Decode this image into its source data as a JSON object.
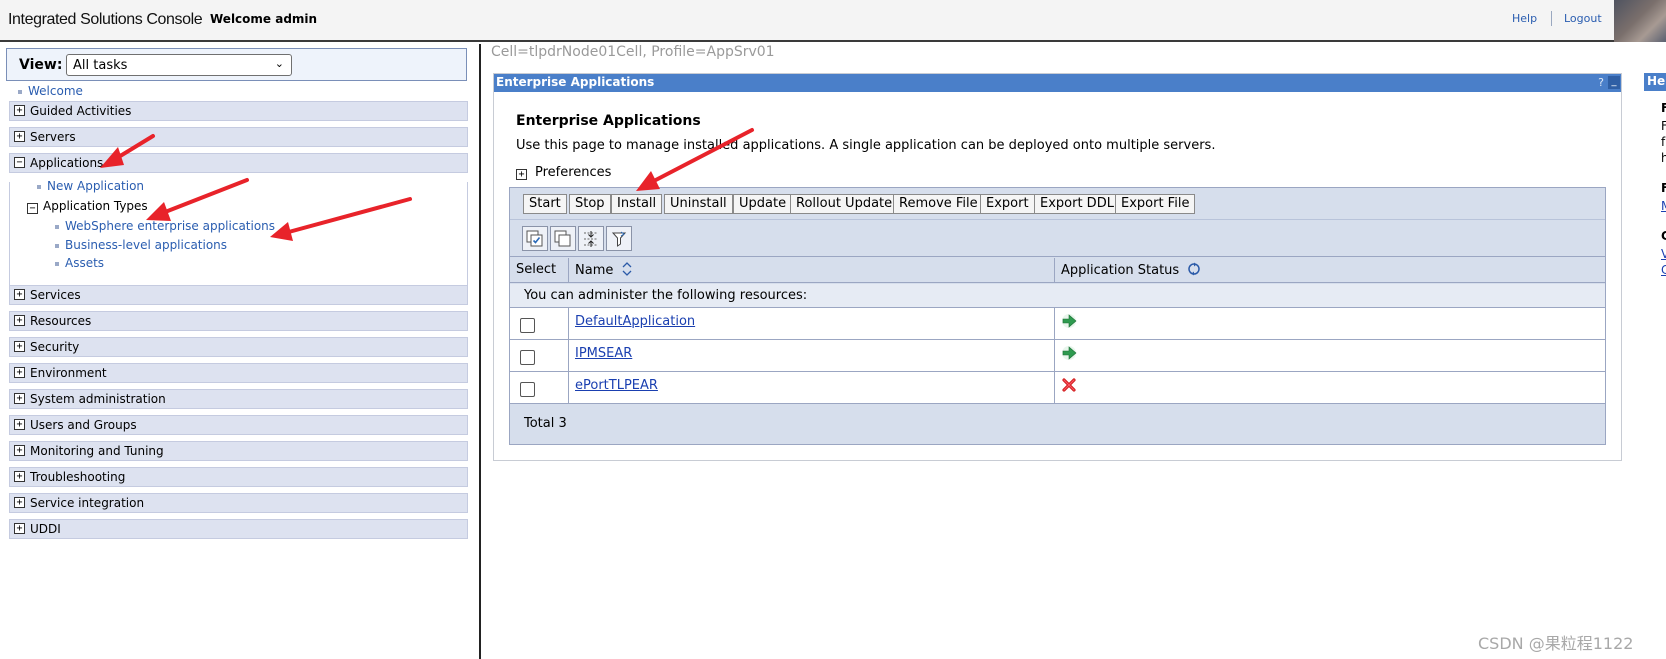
{
  "header": {
    "brand": "Integrated Solutions Console",
    "welcome": "Welcome admin",
    "help": "Help",
    "logout": "Logout"
  },
  "nav": {
    "view_label": "View:",
    "view_value": "All tasks",
    "welcome_link": "Welcome",
    "categories": [
      {
        "label": "Guided Activities",
        "expanded": false
      },
      {
        "label": "Servers",
        "expanded": false
      },
      {
        "label": "Applications",
        "expanded": true
      },
      {
        "label": "Services",
        "expanded": false
      },
      {
        "label": "Resources",
        "expanded": false
      },
      {
        "label": "Security",
        "expanded": false
      },
      {
        "label": "Environment",
        "expanded": false
      },
      {
        "label": "System administration",
        "expanded": false
      },
      {
        "label": "Users and Groups",
        "expanded": false
      },
      {
        "label": "Monitoring and Tuning",
        "expanded": false
      },
      {
        "label": "Troubleshooting",
        "expanded": false
      },
      {
        "label": "Service integration",
        "expanded": false
      },
      {
        "label": "UDDI",
        "expanded": false
      }
    ],
    "applications": {
      "new_application": "New Application",
      "application_types": "Application Types",
      "types": [
        "WebSphere enterprise applications",
        "Business-level applications",
        "Assets"
      ]
    }
  },
  "main": {
    "cell_path": "Cell=tlpdrNode01Cell, Profile=AppSrv01",
    "portlet_title": "Enterprise Applications",
    "help_glyph": "?",
    "minimize_glyph": "_",
    "heading": "Enterprise Applications",
    "description": "Use this page to manage installed applications. A single application can be deployed onto multiple servers.",
    "preferences": "Preferences",
    "buttons": [
      "Start",
      "Stop",
      "Install",
      "Uninstall",
      "Update",
      "Rollout Update",
      "Remove File",
      "Export",
      "Export DDL",
      "Export File"
    ],
    "icon_buttons": [
      "select-all-icon",
      "deselect-all-icon",
      "expand-filter-icon",
      "show-filter-icon"
    ],
    "columns": {
      "select": "Select",
      "name": "Name",
      "status": "Application Status"
    },
    "admin_note": "You can administer the following resources:",
    "rows": [
      {
        "name": "DefaultApplication",
        "status": "started",
        "status_color": "#2e9a4f"
      },
      {
        "name": "IPMSEAR",
        "status": "started",
        "status_color": "#2e9a4f"
      },
      {
        "name": "ePortTLPEAR",
        "status": "stopped",
        "status_color": "#d02020"
      }
    ],
    "total": "Total 3"
  },
  "help_strip": {
    "title": "Help",
    "fragments": [
      "F",
      "F",
      "f",
      "h",
      "F",
      "M",
      "C",
      "V",
      "C"
    ]
  },
  "watermark": "CSDN @果粒程1122",
  "colors": {
    "title_bar": "#4a7fc9",
    "nav_category": "#dde2f0",
    "table_bar": "#d6deec",
    "annotation_arrow": "#e8232a"
  }
}
